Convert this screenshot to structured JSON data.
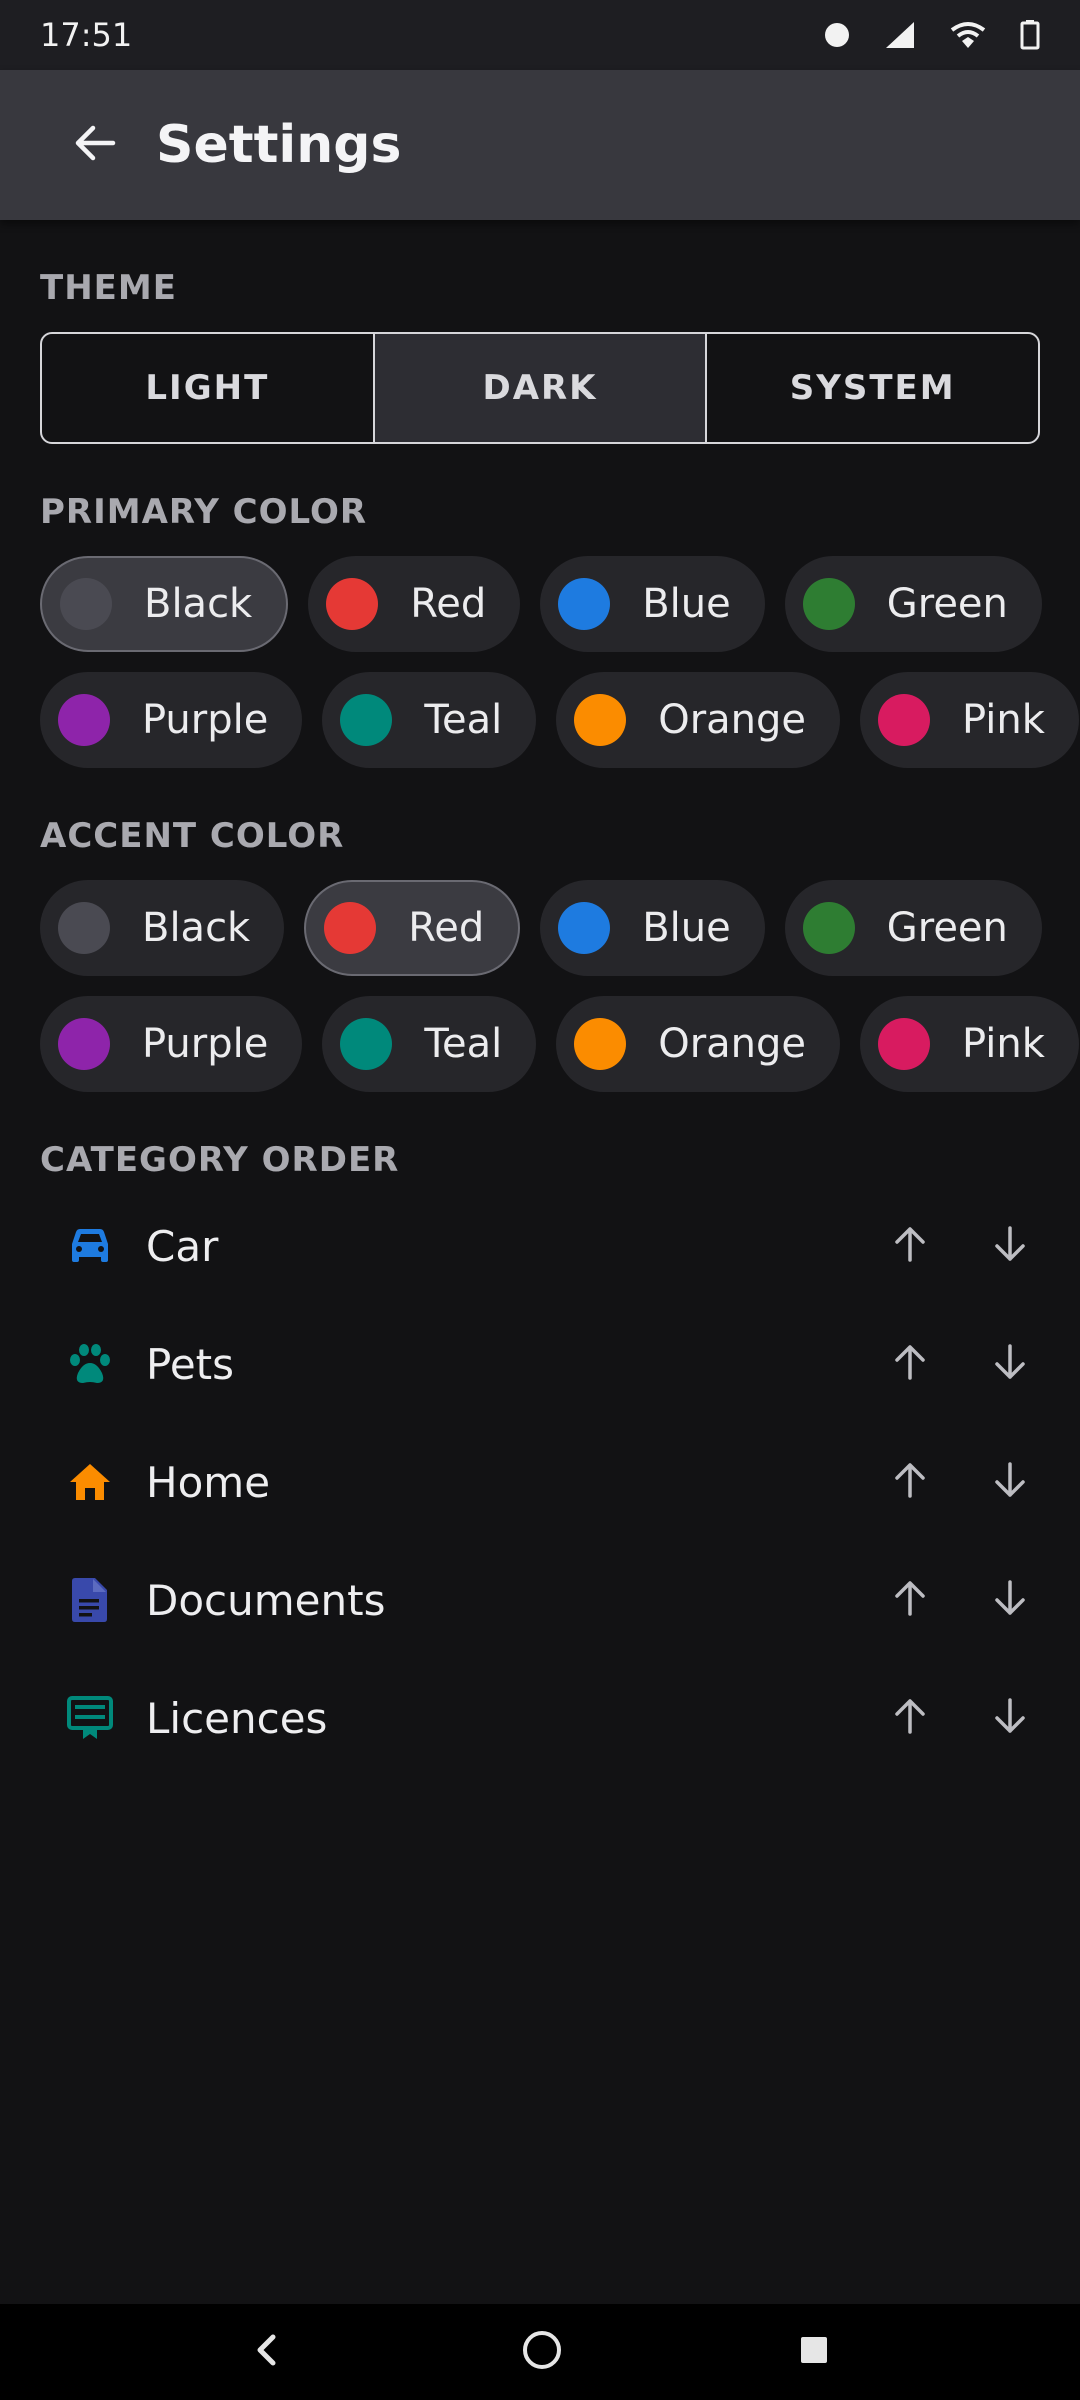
{
  "status_bar": {
    "time": "17:51",
    "icons": [
      "notification-dot-icon",
      "signal-icon",
      "wifi-icon",
      "battery-icon"
    ]
  },
  "app_bar": {
    "title": "Settings",
    "back_icon": "arrow-left-icon"
  },
  "theme": {
    "label": "THEME",
    "options": [
      "LIGHT",
      "DARK",
      "SYSTEM"
    ],
    "selected": "DARK"
  },
  "primary_color": {
    "label": "PRIMARY COLOR",
    "selected": "Black",
    "options": [
      {
        "label": "Black",
        "color": "#4A4A52"
      },
      {
        "label": "Red",
        "color": "#E53935"
      },
      {
        "label": "Blue",
        "color": "#1E7BE0"
      },
      {
        "label": "Green",
        "color": "#2E7D32"
      },
      {
        "label": "Purple",
        "color": "#8E24AA"
      },
      {
        "label": "Teal",
        "color": "#00897B"
      },
      {
        "label": "Orange",
        "color": "#FB8C00"
      },
      {
        "label": "Pink",
        "color": "#D81B60"
      }
    ]
  },
  "accent_color": {
    "label": "ACCENT COLOR",
    "selected": "Red",
    "options": [
      {
        "label": "Black",
        "color": "#4A4A52"
      },
      {
        "label": "Red",
        "color": "#E53935"
      },
      {
        "label": "Blue",
        "color": "#1E7BE0"
      },
      {
        "label": "Green",
        "color": "#2E7D32"
      },
      {
        "label": "Purple",
        "color": "#8E24AA"
      },
      {
        "label": "Teal",
        "color": "#00897B"
      },
      {
        "label": "Orange",
        "color": "#FB8C00"
      },
      {
        "label": "Pink",
        "color": "#D81B60"
      }
    ]
  },
  "category_order": {
    "label": "CATEGORY ORDER",
    "items": [
      {
        "label": "Car",
        "icon": "car-icon",
        "color": "#1E7BE0"
      },
      {
        "label": "Pets",
        "icon": "paw-icon",
        "color": "#00897B"
      },
      {
        "label": "Home",
        "icon": "home-icon",
        "color": "#FB8C00"
      },
      {
        "label": "Documents",
        "icon": "document-icon",
        "color": "#3949AB"
      },
      {
        "label": "Licences",
        "icon": "licence-icon",
        "color": "#00897B"
      }
    ],
    "move_up_icon": "arrow-up-icon",
    "move_down_icon": "arrow-down-icon"
  },
  "nav_bar": {
    "icons": [
      "nav-back-icon",
      "nav-home-icon",
      "nav-recents-icon"
    ]
  }
}
